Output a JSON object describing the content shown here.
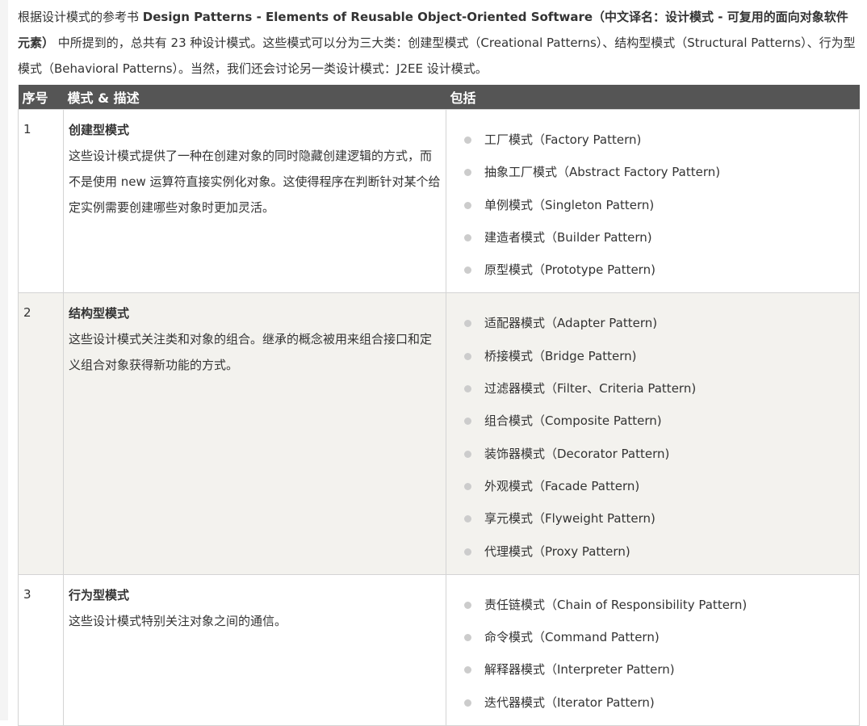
{
  "intro": {
    "part1": "根据设计模式的参考书 ",
    "book_title": "Design Patterns - Elements of Reusable Object-Oriented Software（中文译名：设计模式 - 可复用的面向对象软件元素）",
    "part2": " 中所提到的，总共有 23 种设计模式。这些模式可以分为三大类：创建型模式（Creational Patterns）、结构型模式（Structural Patterns）、行为型模式（Behavioral Patterns）。当然，我们还会讨论另一类设计模式：J2EE 设计模式。"
  },
  "table": {
    "headers": {
      "no": "序号",
      "desc": "模式 & 描述",
      "includes": "包括"
    },
    "rows": [
      {
        "no": "1",
        "title": "创建型模式",
        "description": "这些设计模式提供了一种在创建对象的同时隐藏创建逻辑的方式，而不是使用 new 运算符直接实例化对象。这使得程序在判断针对某个给定实例需要创建哪些对象时更加灵活。",
        "patterns": [
          "工厂模式（Factory Pattern)",
          "抽象工厂模式（Abstract Factory Pattern)",
          "单例模式（Singleton Pattern)",
          "建造者模式（Builder Pattern)",
          "原型模式（Prototype Pattern)"
        ]
      },
      {
        "no": "2",
        "title": "结构型模式",
        "description": "这些设计模式关注类和对象的组合。继承的概念被用来组合接口和定义组合对象获得新功能的方式。",
        "patterns": [
          "适配器模式（Adapter Pattern)",
          "桥接模式（Bridge Pattern)",
          "过滤器模式（Filter、Criteria Pattern)",
          "组合模式（Composite Pattern)",
          "装饰器模式（Decorator Pattern)",
          "外观模式（Facade Pattern)",
          "享元模式（Flyweight Pattern)",
          "代理模式（Proxy Pattern)"
        ]
      },
      {
        "no": "3",
        "title": "行为型模式",
        "description": "这些设计模式特别关注对象之间的通信。",
        "patterns": [
          "责任链模式（Chain of Responsibility Pattern)",
          "命令模式（Command Pattern)",
          "解释器模式（Interpreter Pattern)",
          "迭代器模式（Iterator Pattern)"
        ]
      }
    ]
  }
}
